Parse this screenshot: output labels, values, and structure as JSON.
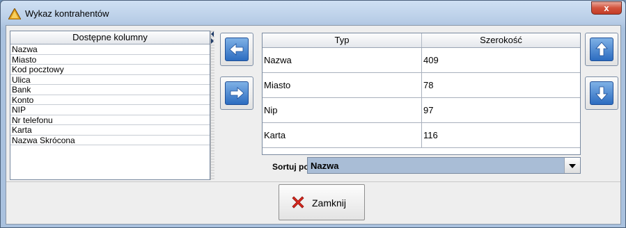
{
  "window": {
    "title": "Wykaz kontrahentów",
    "close_glyph": "x"
  },
  "available": {
    "header": "Dostępne kolumny",
    "items": [
      "Nazwa",
      "Miasto",
      "Kod pocztowy",
      "Ulica",
      "Bank",
      "Konto",
      "NIP",
      "Nr telefonu",
      "Karta",
      "Nazwa Skrócona"
    ]
  },
  "buttons": {
    "move_left_icon": "arrow-left-icon",
    "move_right_icon": "arrow-right-icon",
    "move_up_icon": "arrow-up-icon",
    "move_down_icon": "arrow-down-icon"
  },
  "grid": {
    "headers": [
      "Typ",
      "Szerokość"
    ],
    "rows": [
      {
        "type": "Nazwa",
        "width": "409"
      },
      {
        "type": "Miasto",
        "width": "78"
      },
      {
        "type": "Nip",
        "width": "97"
      },
      {
        "type": "Karta",
        "width": "116"
      }
    ]
  },
  "sort": {
    "label": "Sortuj po:",
    "value": "Nazwa"
  },
  "close_button": {
    "label": "Zamknij"
  },
  "colors": {
    "accent": "#2c6cc0",
    "close_x": "#d8281e"
  }
}
